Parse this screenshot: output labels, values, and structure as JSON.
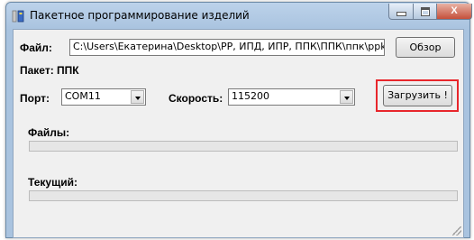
{
  "window": {
    "title": "Пакетное программирование изделий",
    "controls": {
      "minimize": "—",
      "maximize": "□",
      "close": "X"
    }
  },
  "file": {
    "label": "Файл:",
    "path": "C:\\Users\\Екатерина\\Desktop\\РР, ИПД, ИПР, ППК\\ППК\\ппк\\ppk-",
    "browse_label": "Обзор"
  },
  "package": {
    "label": "Пакет: ППК"
  },
  "port": {
    "label": "Порт:",
    "value": "COM11"
  },
  "speed": {
    "label": "Скорость:",
    "value": "115200"
  },
  "load_button": {
    "label": "Загрузить !",
    "highlight_color": "#e8262c"
  },
  "files": {
    "label": "Файлы:",
    "progress": 0
  },
  "current": {
    "label": "Текущий:",
    "progress": 0
  }
}
